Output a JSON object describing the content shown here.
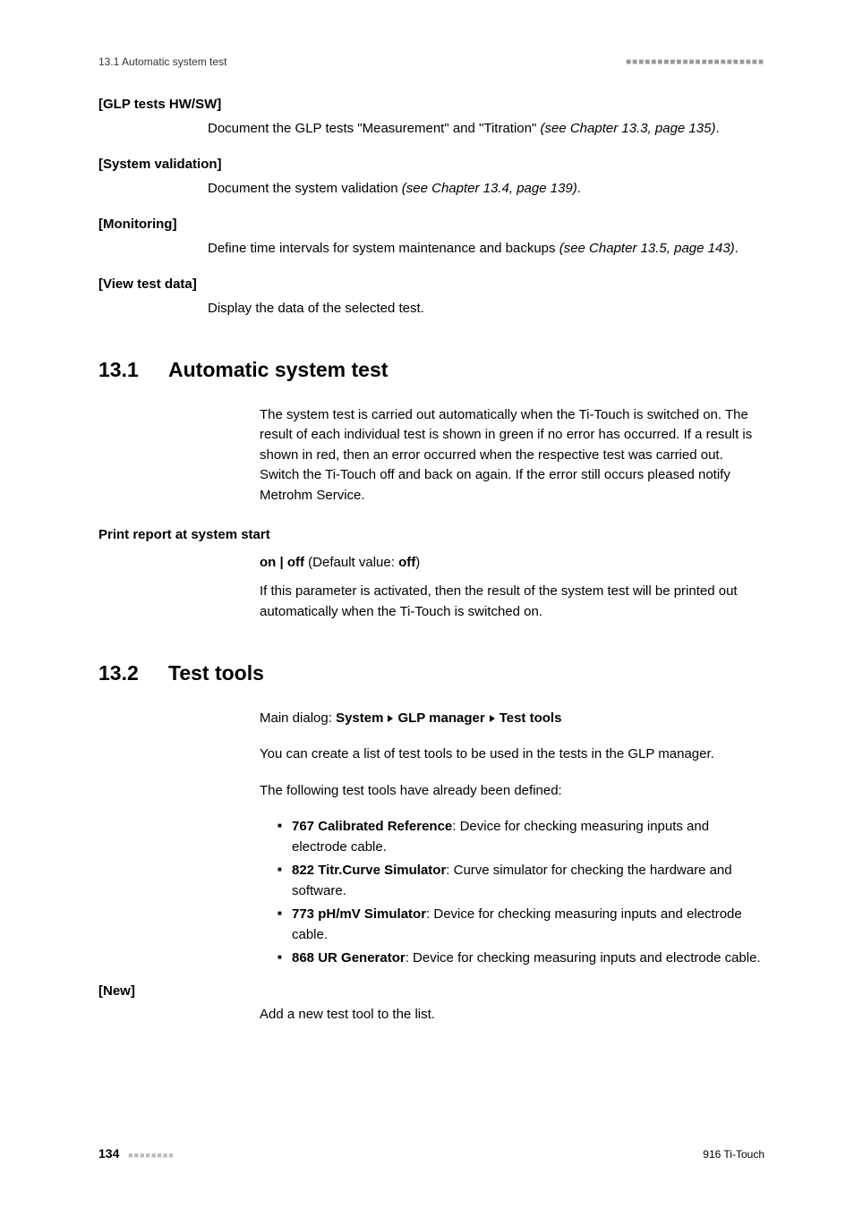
{
  "header": {
    "left": "13.1 Automatic system test"
  },
  "defs": {
    "glp": {
      "term": "[GLP tests HW/SW]",
      "desc_pre": "Document the GLP tests \"Measurement\" and \"Titration\" ",
      "desc_ref": "(see Chapter 13.3, page 135)",
      "desc_post": "."
    },
    "sysval": {
      "term": "[System validation]",
      "desc_pre": "Document the system validation ",
      "desc_ref": "(see Chapter 13.4, page 139)",
      "desc_post": "."
    },
    "monitoring": {
      "term": "[Monitoring]",
      "desc_pre": "Define time intervals for system maintenance and backups ",
      "desc_ref": "(see Chapter 13.5, page 143)",
      "desc_post": "."
    },
    "viewtest": {
      "term": "[View test data]",
      "desc": "Display the data of the selected test."
    }
  },
  "section131": {
    "num": "13.1",
    "title": "Automatic system test",
    "para": "The system test is carried out automatically when the Ti-Touch is switched on. The result of each individual test is shown in green if no error has occurred. If a result is shown in red, then an error occurred when the respective test was carried out. Switch the Ti-Touch off and back on again. If the error still occurs pleased notify Metrohm Service.",
    "param_name": "Print report at system start",
    "param_values_pre": "on | off",
    "param_values_default_label": " (Default value: ",
    "param_values_default": "off",
    "param_values_post": ")",
    "param_desc": "If this parameter is activated, then the result of the system test will be printed out automatically when the Ti-Touch is switched on."
  },
  "section132": {
    "num": "13.2",
    "title": "Test tools",
    "dialog_label": "Main dialog: ",
    "dialog_path": [
      "System",
      "GLP manager",
      "Test tools"
    ],
    "para1": "You can create a list of test tools to be used in the tests in the GLP manager.",
    "para2": "The following test tools have already been defined:",
    "tools": [
      {
        "name": "767 Calibrated Reference",
        "desc": ": Device for checking measuring inputs and electrode cable."
      },
      {
        "name": "822 Titr.Curve Simulator",
        "desc": ": Curve simulator for checking the hardware and software."
      },
      {
        "name": "773 pH/mV Simulator",
        "desc": ": Device for checking measuring inputs and electrode cable."
      },
      {
        "name": "868 UR Generator",
        "desc": ": Device for checking measuring inputs and electrode cable."
      }
    ],
    "new": {
      "term": "[New]",
      "desc": "Add a new test tool to the list."
    }
  },
  "footer": {
    "page": "134",
    "right": "916 Ti-Touch"
  }
}
